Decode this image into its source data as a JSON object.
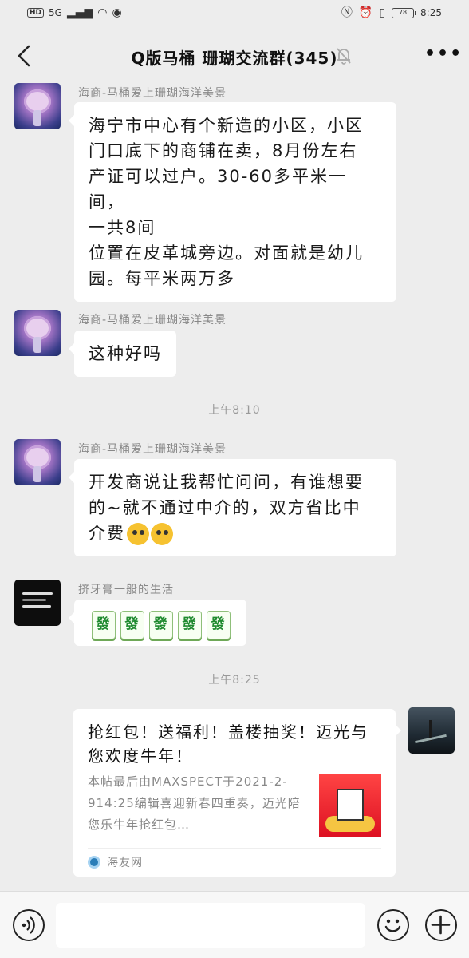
{
  "status_bar": {
    "hd": "HD",
    "network": "5G",
    "battery": "78",
    "time": "8:25"
  },
  "header": {
    "title": "Q版马桶 珊瑚交流群(345)",
    "more": "•••"
  },
  "messages": [
    {
      "sender": "海商-马桶爱上珊瑚海洋美景",
      "lines": [
        "海宁市中心有个新造的小区，小区",
        "门口底下的商铺在卖，8月份左右",
        "产证可以过户。30-60多平米一间，",
        "一共8间",
        "位置在皮革城旁边。对面就是幼儿",
        "园。每平米两万多"
      ]
    },
    {
      "sender": "海商-马桶爱上珊瑚海洋美景",
      "text": "这种好吗"
    },
    {
      "sender": "海商-马桶爱上珊瑚海洋美景",
      "lines": [
        "开发商说让我帮忙问问，有谁想要",
        "的~就不通过中介的，双方省比中",
        "介费"
      ]
    },
    {
      "sender": "挤牙膏一般的生活",
      "tiles": [
        "發",
        "發",
        "發",
        "發",
        "發"
      ]
    }
  ],
  "timestamps": [
    "上午8:10",
    "上午8:25"
  ],
  "card": {
    "title": "抢红包！送福利！盖楼抽奖！迈光与您欢度牛年！",
    "desc": "本帖最后由MAXSPECT于2021-2-914:25编辑喜迎新春四重奏，迈光陪您乐牛年抢红包…",
    "source": "海友网"
  },
  "icons": {
    "back": "chevron-left-icon",
    "mute": "bell-off-icon",
    "voice": "voice-icon",
    "emoji": "smiley-icon",
    "plus": "plus-icon"
  }
}
